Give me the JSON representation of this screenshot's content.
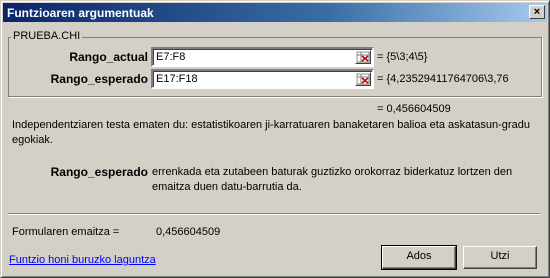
{
  "window": {
    "title": "Funtzioaren argumentuak",
    "close_glyph": "×"
  },
  "function_name": "PRUEBA.CHI",
  "arguments": [
    {
      "label": "Rango_actual",
      "value": "E7:F8",
      "result": "= {5\\3;4\\5}"
    },
    {
      "label": "Rango_esperado",
      "value": "E17:F18",
      "result": "= {4,23529411764706\\3,76"
    }
  ],
  "function_result": "= 0,456604509",
  "function_description": "Independentziaren testa ematen du: estatistikoaren ji-karratuaren banaketaren balioa eta askatasun-gradu egokiak.",
  "argument_help": {
    "label": "Rango_esperado",
    "text": "errenkada eta zutabeen baturak guztizko orokorraz biderkatuz lortzen den emaitza duen datu-barrutia da."
  },
  "formula_result": {
    "label": "Formularen emaitza =",
    "value": "0,456604509"
  },
  "buttons": {
    "ok": "Ados",
    "cancel": "Utzi"
  },
  "help_link": "Funtzio honi buruzko laguntza",
  "colors": {
    "title_start": "#0a246a",
    "title_end": "#a6caf0",
    "face": "#d4d0c8",
    "link": "#0000ff"
  }
}
